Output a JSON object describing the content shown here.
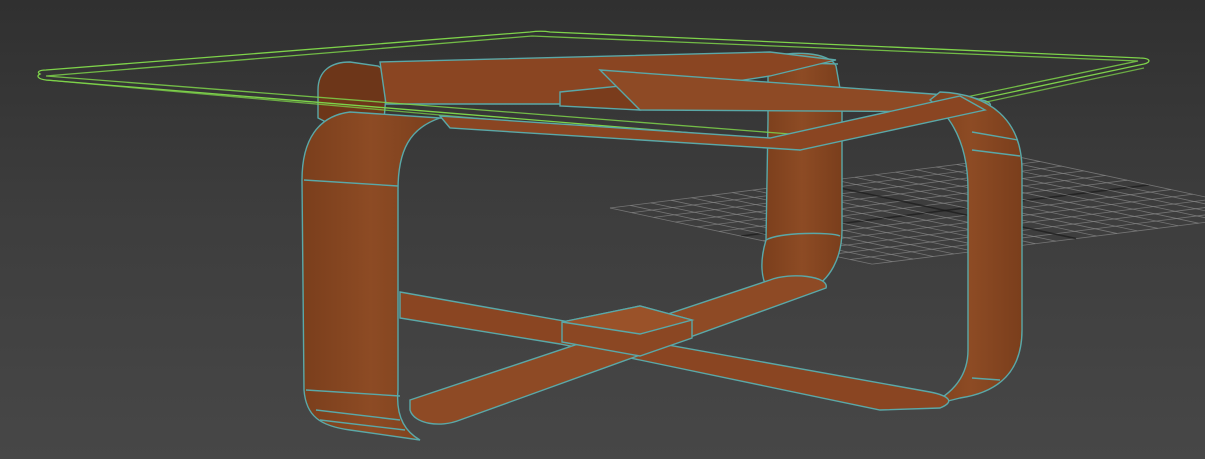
{
  "viewport": {
    "view": "Perspective",
    "background_color": "#3c3c3c",
    "grid_color": "#8c8c8c",
    "grid_axis_color": "#1a1a1a",
    "objects": [
      {
        "name": "glass_top",
        "display": "wireframe",
        "wire_color": "#7ed34a"
      },
      {
        "name": "table_frame",
        "display": "shaded",
        "color": "#8a4a25",
        "edge_color": "#5ab3b3"
      }
    ]
  }
}
